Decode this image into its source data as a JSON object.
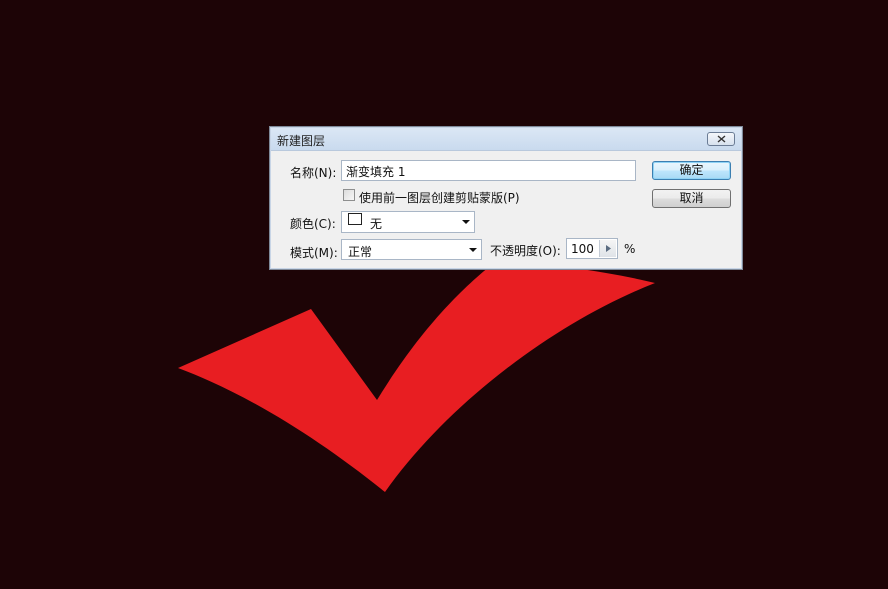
{
  "dialog": {
    "title": "新建图层",
    "close_label": "✕",
    "name_label": "名称(N):",
    "name_value": "渐变填充 1",
    "clip_checkbox_label": "使用前一图层创建剪贴蒙版(P)",
    "clip_checkbox_checked": false,
    "color_label": "颜色(C):",
    "color_value": "无",
    "mode_label": "模式(M):",
    "mode_value": "正常",
    "opacity_label": "不透明度(O):",
    "opacity_value": "100",
    "opacity_unit": "%",
    "ok_label": "确定",
    "cancel_label": "取消"
  },
  "colors": {
    "background": "#1d0406",
    "checkmark": "#e81e22",
    "highlight": "#e81e22"
  },
  "icons": {
    "close": "close-icon",
    "dropdown": "chevron-down-icon",
    "slider": "triangle-right-icon"
  }
}
